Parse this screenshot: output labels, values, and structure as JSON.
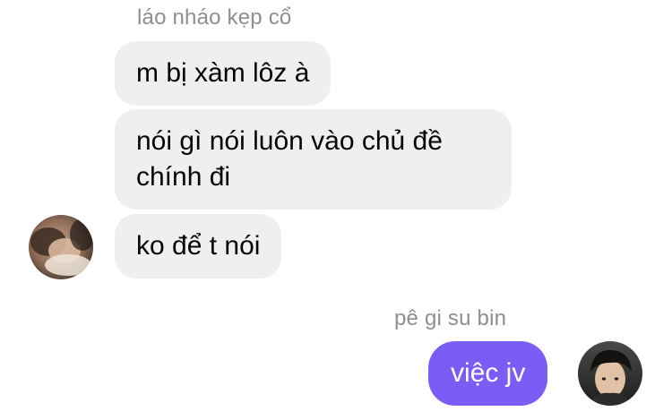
{
  "thread": {
    "incoming_group": {
      "sender_name": "láo nháo kẹp cổ",
      "messages": [
        {
          "text": "m bị xàm lôz à"
        },
        {
          "text": "nói gì nói luôn vào chủ đề chính đi"
        },
        {
          "text": "ko để t nói"
        }
      ],
      "avatar_icon": "contact-avatar-photo"
    },
    "outgoing_group": {
      "sender_name": "pê gi su bin",
      "messages": [
        {
          "text": "việc jv"
        }
      ],
      "avatar_icon": "own-avatar-photo"
    }
  },
  "colors": {
    "incoming_bubble": "#efefef",
    "outgoing_bubble": "#7b5cf5",
    "sender_name": "#8e8e93"
  }
}
